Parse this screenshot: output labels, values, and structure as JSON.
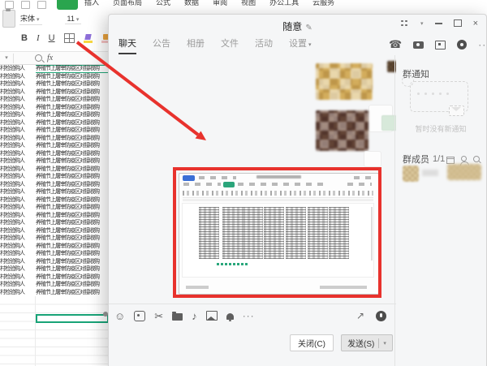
{
  "excel": {
    "menu": [
      "插入",
      "页面布局",
      "公式",
      "数据",
      "审阅",
      "视图",
      "办公工具",
      "云服务"
    ],
    "font_name": "宋体",
    "font_size": "11",
    "format_buttons": [
      "B",
      "I",
      "U"
    ],
    "formula_label": "fx",
    "rows": [
      {
        "c1": "村检验购人",
        "c2": "养殖节上屠宰防疫区对接收购"
      },
      {
        "c1": "村检验购人",
        "c2": "养殖节上屠宰防疫区对接收购"
      },
      {
        "c1": "村检验购人",
        "c2": "养殖节上屠宰防疫区对接收购"
      },
      {
        "c1": "村检验购人",
        "c2": "养殖节上屠宰防疫区对接收购"
      },
      {
        "c1": "村检验购人",
        "c2": "养殖节上屠宰防疫区对接收购"
      },
      {
        "c1": "村检验购人",
        "c2": "养殖节上屠宰防疫区对接收购"
      },
      {
        "c1": "村检验购人",
        "c2": "养殖节上屠宰防疫区对接收购"
      },
      {
        "c1": "村检验购人",
        "c2": "养殖节上屠宰防疫区对接收购"
      },
      {
        "c1": "村检验购人",
        "c2": "养殖节上屠宰防疫区对接收购"
      },
      {
        "c1": "村检验购人",
        "c2": "养殖节上屠宰防疫区对接收购"
      },
      {
        "c1": "村检验购人",
        "c2": "养殖节上屠宰防疫区对接收购"
      },
      {
        "c1": "村检验购人",
        "c2": "养殖节上屠宰防疫区对接收购"
      },
      {
        "c1": "村检验购人",
        "c2": "养殖节上屠宰防疫区对接收购"
      },
      {
        "c1": "村检验购人",
        "c2": "养殖节上屠宰防疫区对接收购"
      },
      {
        "c1": "村检验购人",
        "c2": "养殖节上屠宰防疫区对接收购"
      },
      {
        "c1": "村检验购人",
        "c2": "养殖节上屠宰防疫区对接收购"
      },
      {
        "c1": "村检验购人",
        "c2": "养殖节上屠宰防疫区对接收购"
      },
      {
        "c1": "村检验购人",
        "c2": "养殖节上屠宰防疫区对接收购"
      },
      {
        "c1": "村检验购人",
        "c2": "养殖节上屠宰防疫区对接收购"
      },
      {
        "c1": "村检验购人",
        "c2": "养殖节上屠宰防疫区对接收购"
      },
      {
        "c1": "村检验购人",
        "c2": "养殖节上屠宰防疫区对接收购"
      },
      {
        "c1": "村检验购人",
        "c2": "养殖节上屠宰防疫区对接收购"
      },
      {
        "c1": "村检验购人",
        "c2": "养殖节上屠宰防疫区对接收购"
      },
      {
        "c1": "村检验购人",
        "c2": "养殖节上屠宰防疫区对接收购"
      },
      {
        "c1": "村检验购人",
        "c2": "养殖节上屠宰防疫区对接收购"
      },
      {
        "c1": "村检验购人",
        "c2": "养殖节上屠宰防疫区对接收购"
      },
      {
        "c1": "村检验购人",
        "c2": "养殖节上屠宰防疫区对接收购"
      },
      {
        "c1": "村检验购人",
        "c2": "养殖节上屠宰防疫区对接收购"
      },
      {
        "c1": "村检验购人",
        "c2": "养殖节上屠宰防疫区对接收购"
      },
      {
        "c1": "村检验购人",
        "c2": "养殖节上屠宰防疫区对接收购"
      }
    ]
  },
  "chat": {
    "title": "随意",
    "tabs": [
      {
        "label": "聊天",
        "active": true
      },
      {
        "label": "公告",
        "active": false
      },
      {
        "label": "相册",
        "active": false
      },
      {
        "label": "文件",
        "active": false
      },
      {
        "label": "活动",
        "active": false
      },
      {
        "label": "设置",
        "active": false,
        "caret": true
      }
    ],
    "close_button": "关闭(C)",
    "send_button": "发送(S)",
    "sidebar": {
      "notice_title": "群通知",
      "notice_empty_text": "暂时没有新通知",
      "members_title": "群成员",
      "members_count": "1/1"
    }
  },
  "colors": {
    "annotation_red": "#e8322d",
    "wps_green": "#2aa54e",
    "selection_teal": "#18a377"
  }
}
